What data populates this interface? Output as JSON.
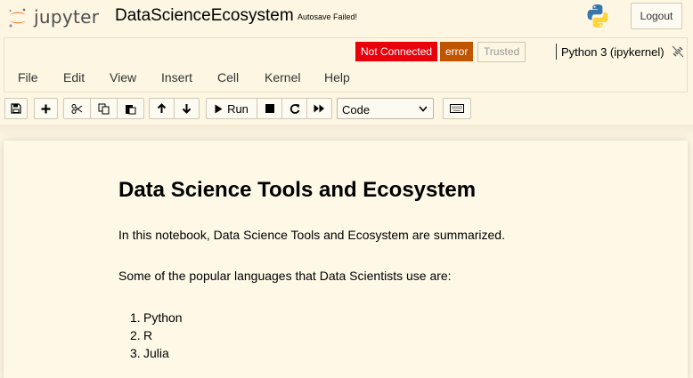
{
  "header": {
    "logo_text": "jupyter",
    "notebook_name": "DataScienceEcosystem",
    "autosave_status": "Autosave Failed!",
    "logout_label": "Logout",
    "icons": {
      "logo": "jupyter-logo-icon",
      "python": "python-logo-icon"
    }
  },
  "status": {
    "not_connected": "Not Connected",
    "error": "error",
    "trusted": "Trusted",
    "kernel_name": "Python 3 (ipykernel)",
    "kernel_icon": "kernel-disconnected-icon",
    "colors": {
      "not_connected": "#e8000b",
      "error": "#c05500"
    }
  },
  "menu": {
    "items": [
      "File",
      "Edit",
      "View",
      "Insert",
      "Cell",
      "Kernel",
      "Help"
    ]
  },
  "toolbar": {
    "run_label": "Run",
    "cell_type": "Code",
    "icons": [
      "save-icon",
      "plus-icon",
      "cut-icon",
      "copy-icon",
      "paste-icon",
      "arrow-up-icon",
      "arrow-down-icon",
      "run-icon",
      "stop-icon",
      "restart-icon",
      "fast-forward-icon",
      "keyboard-icon"
    ]
  },
  "notebook": {
    "heading": "Data Science Tools and Ecosystem",
    "intro": "In this notebook, Data Science Tools and Ecosystem are summarized.",
    "languages_intro": "Some of the popular languages that Data Scientists use are:",
    "languages": [
      {
        "num": "1.",
        "name": "Python"
      },
      {
        "num": "2.",
        "name": "R"
      },
      {
        "num": "3.",
        "name": "Julia"
      }
    ]
  }
}
